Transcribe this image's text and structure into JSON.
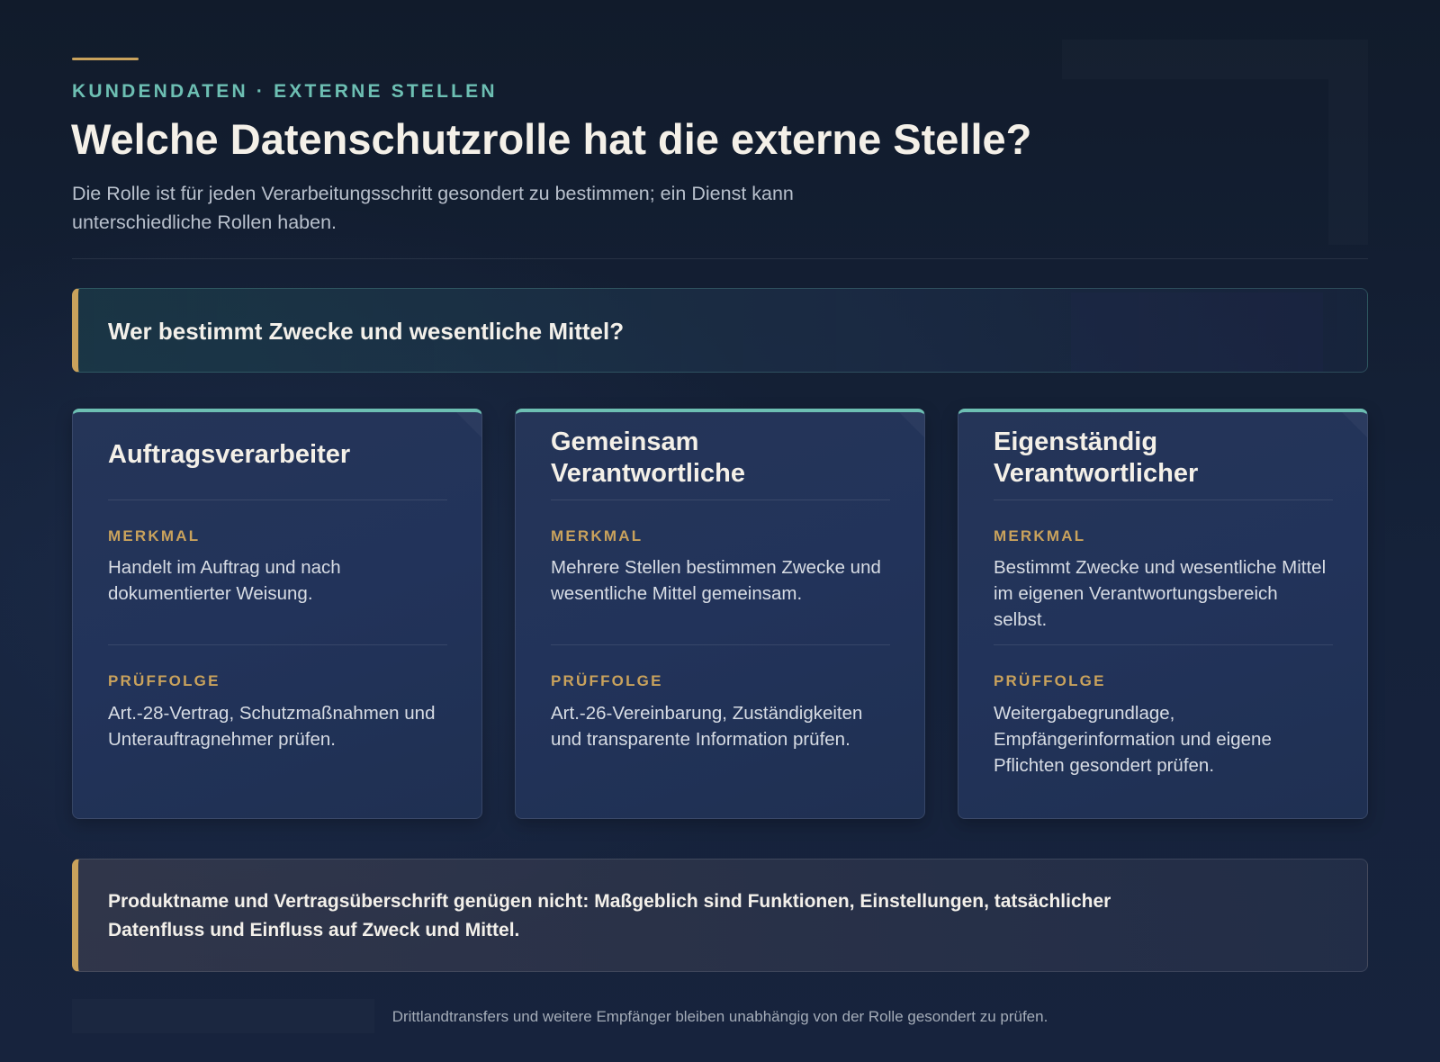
{
  "header": {
    "eyebrow": "KUNDENDATEN · EXTERNE STELLEN",
    "title": "Welche Datenschutzrolle hat die externe Stelle?",
    "subtitle": "Die Rolle ist für jeden Verarbeitungsschritt gesondert zu bestimmen; ein Dienst kann unterschiedliche Rollen haben."
  },
  "question": "Wer bestimmt Zwecke und wesentliche Mittel?",
  "cards": [
    {
      "title": "Auftragsverarbeiter",
      "feature_label": "MERKMAL",
      "feature_text": "Handelt im Auftrag und nach dokumentierter Weisung.",
      "check_label": "PRÜFFOLGE",
      "check_text": "Art.-28-Vertrag, Schutzmaßnahmen und Unterauftragnehmer prüfen."
    },
    {
      "title": "Gemeinsam Verantwortliche",
      "feature_label": "MERKMAL",
      "feature_text": "Mehrere Stellen bestimmen Zwecke und wesentliche Mittel gemeinsam.",
      "check_label": "PRÜFFOLGE",
      "check_text": "Art.-26-Vereinbarung, Zuständigkeiten und transparente Information prüfen."
    },
    {
      "title": "Eigenständig Verantwortlicher",
      "feature_label": "MERKMAL",
      "feature_text": "Bestimmt Zwecke und wesentliche Mittel im eigenen Verantwortungsbereich selbst.",
      "check_label": "PRÜFFOLGE",
      "check_text": "Weitergabegrundlage, Empfängerinformation und eigene Pflichten gesondert prüfen."
    }
  ],
  "note": "Produktname und Vertragsüberschrift genügen nicht: Maßgeblich sind Funktionen, Einstellungen, tatsächlicher Datenfluss und Einfluss auf Zweck und Mittel.",
  "footer": "Drittlandtransfers und weitere Empfänger bleiben unabhängig von der Rolle gesondert zu prüfen.",
  "colors": {
    "accent_gold": "#c9a25c",
    "accent_teal": "#6dbfb3",
    "background": "#132036"
  }
}
